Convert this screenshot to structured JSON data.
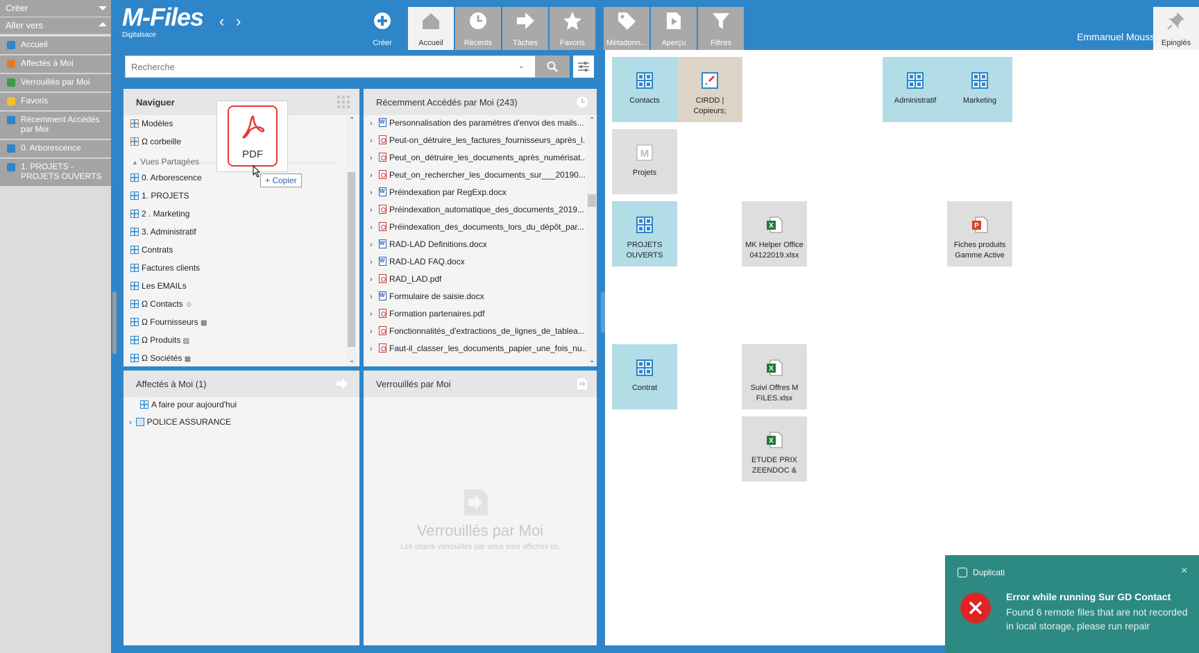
{
  "sidebar": {
    "create": "Créer",
    "goto": "Aller vers",
    "items": [
      {
        "label": "Accueil",
        "color": "#2e86c9"
      },
      {
        "label": "Affectés à Moi",
        "color": "#2e86c9"
      },
      {
        "label": "Verrouillés par Moi",
        "color": "#2e86c9"
      },
      {
        "label": "Favoris",
        "color": "#f2c12e"
      },
      {
        "label": "Récemment Accédés par Moi",
        "color": "#2e86c9"
      },
      {
        "label": "0.  Arborescence",
        "color": "#2e86c9"
      },
      {
        "label": "1. PROJETS - PROJETS OUVERTS",
        "color": "#2e86c9"
      }
    ]
  },
  "topbar": {
    "logo": "M-Files",
    "logo_sub": "Digitalsace",
    "buttons": [
      "Créer",
      "Accueil",
      "Récents",
      "Tâches",
      "Favoris",
      "Métadonn...",
      "Aperçu",
      "Filtres",
      "Epinglés"
    ],
    "user": "Emmanuel Moussu"
  },
  "search": {
    "placeholder": "Recherche"
  },
  "navigate": {
    "title": "Naviguer",
    "items_top": [
      "Modèles",
      "Ω corbeille"
    ],
    "shared_views": "Vues Partagées",
    "items": [
      "0.  Arborescence",
      "1. PROJETS",
      "2 . Marketing",
      "3. Administratif",
      "Contrats",
      "Factures clients",
      "Les EMAILs",
      "Ω Contacts",
      "Ω Fournisseurs",
      "Ω Produits",
      "Ω Sociétés"
    ]
  },
  "drag": {
    "file_label": "PDF",
    "copy_label": "+ Copier"
  },
  "recent": {
    "title": "Récemment Accédés par Moi (243)",
    "items": [
      {
        "name": "Personnalisation des paramètres d'envoi des mails...",
        "type": "doc"
      },
      {
        "name": "Peut-on_détruire_les_factures_fournisseurs_après_l...",
        "type": "pdf"
      },
      {
        "name": "Peut_on_détruire_les_documents_après_numérisat...",
        "type": "pdf"
      },
      {
        "name": "Peut_on_rechercher_les_documents_sur___20190...",
        "type": "pdf"
      },
      {
        "name": "Préindexation par RegExp.docx",
        "type": "doc"
      },
      {
        "name": "Préindexation_automatique_des_documents_2019...",
        "type": "pdf"
      },
      {
        "name": "Préindexation_des_documents_lors_du_dépôt_par...",
        "type": "pdf"
      },
      {
        "name": "RAD-LAD Definitions.docx",
        "type": "doc"
      },
      {
        "name": "RAD-LAD FAQ.docx",
        "type": "doc"
      },
      {
        "name": "RAD_LAD.pdf",
        "type": "pdf"
      },
      {
        "name": "Formulaire de saisie.docx",
        "type": "doc"
      },
      {
        "name": "Formation partenaires.pdf",
        "type": "pdf"
      },
      {
        "name": "Fonctionnalités_d'extractions_de_lignes_de_tablea...",
        "type": "pdf"
      },
      {
        "name": "Faut-il_classer_les_documents_papier_une_fois_nu...",
        "type": "pdf"
      }
    ]
  },
  "assigned": {
    "title": "Affectés à Moi (1)",
    "items": [
      "A faire pour aujourd'hui",
      "POLICE ASSURANCE"
    ]
  },
  "locked": {
    "title": "Verrouillés par Moi",
    "empty_title": "Verrouillés par Moi",
    "empty_sub": "Les objets verrouillés par vous sont affichés ici."
  },
  "tiles": [
    {
      "label": "Contacts",
      "style": "blue",
      "icon": "grid"
    },
    {
      "label": "CIRDD   |   Copieurs;",
      "style": "tan",
      "icon": "rocket"
    },
    {
      "label": "Administratif",
      "style": "blue",
      "icon": "grid"
    },
    {
      "label": "Marketing",
      "style": "blue",
      "icon": "grid"
    },
    {
      "label": "Projets",
      "style": "grey",
      "icon": "mfiles"
    },
    {
      "label": "PROJETS OUVERTS",
      "style": "blue",
      "icon": "grid"
    },
    {
      "label": "MK Helper Office 04122019.xlsx",
      "style": "grey",
      "icon": "excel"
    },
    {
      "label": "Fiches produits Gamme Active",
      "style": "grey",
      "icon": "ppt"
    },
    {
      "label": "Contrat",
      "style": "blue",
      "icon": "grid"
    },
    {
      "label": "Suivi Offres M FILES.xlsx",
      "style": "grey",
      "icon": "excel"
    },
    {
      "label": "ETUDE PRIX ZEENDOC &",
      "style": "grey",
      "icon": "excel"
    }
  ],
  "toast": {
    "app": "Duplicati",
    "title": "Error while running Sur GD Contact",
    "message": "Found 6 remote files that are not recorded in local storage, please run repair"
  }
}
